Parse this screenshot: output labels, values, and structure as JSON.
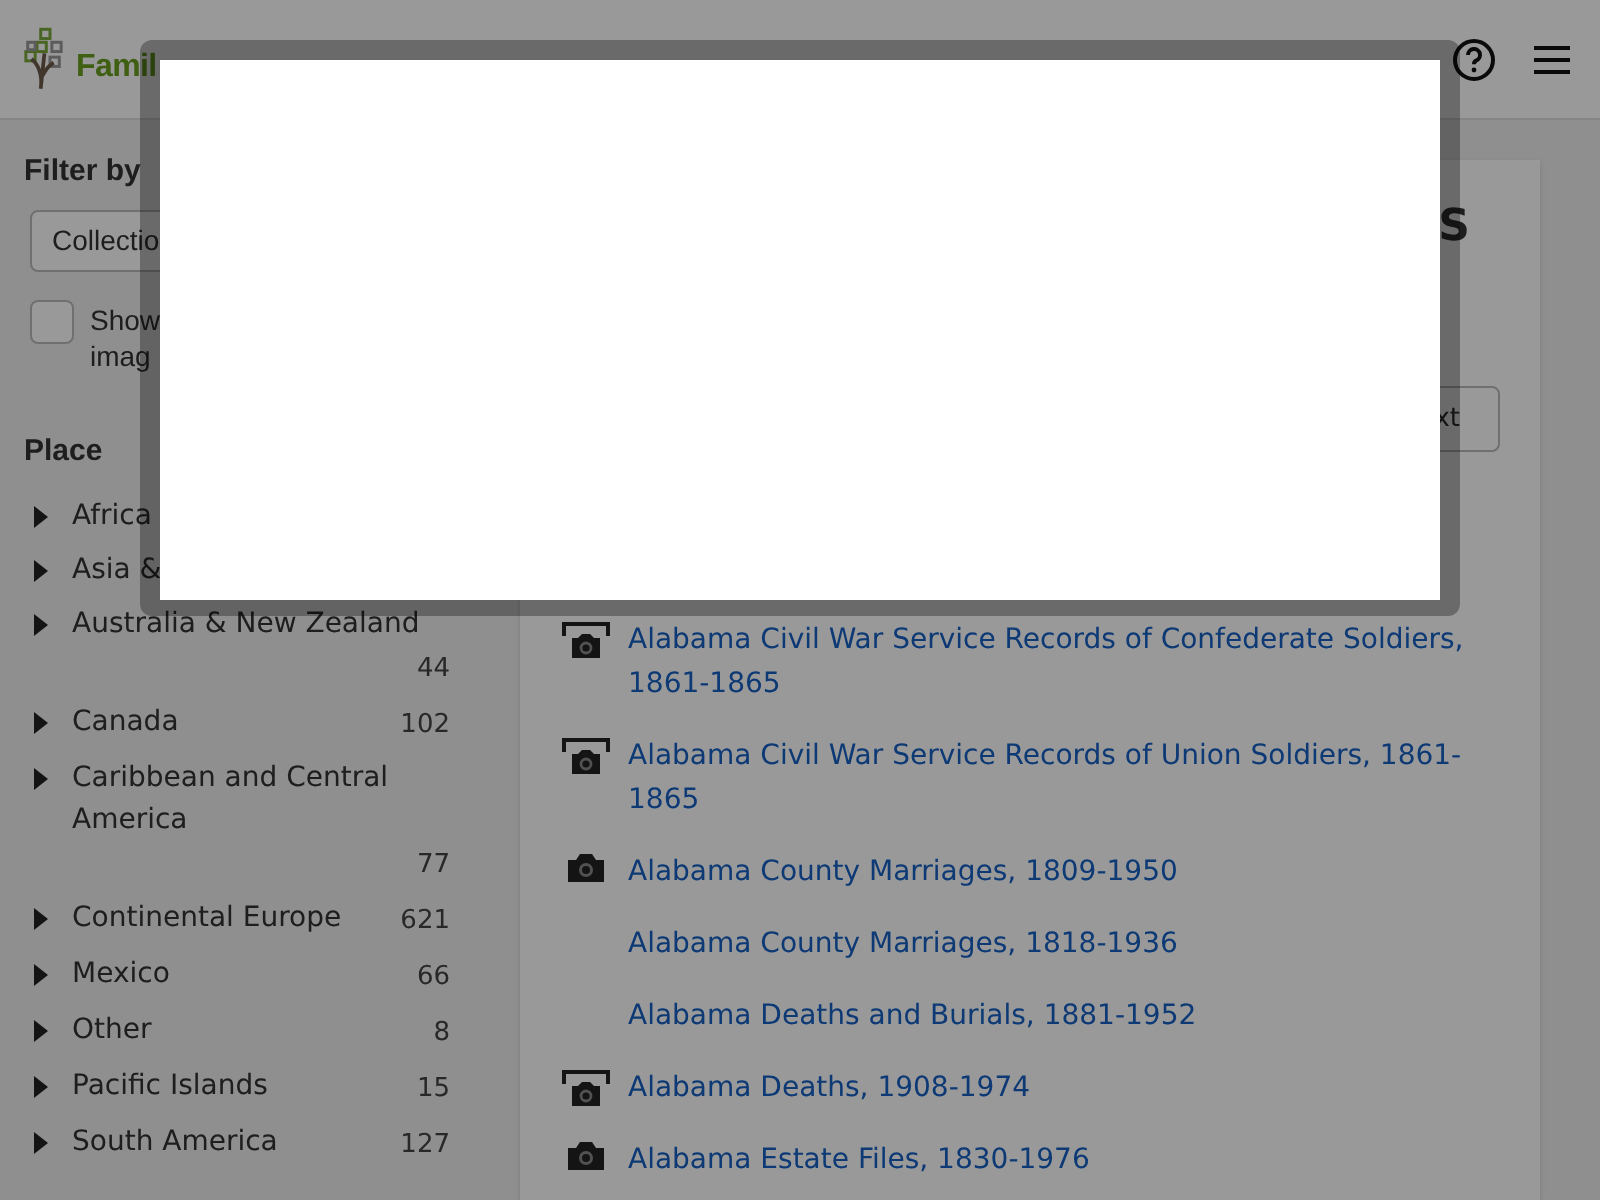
{
  "header": {
    "logo_text": "Famil"
  },
  "sidebar": {
    "title": "Filter by",
    "select": {
      "value": "Collectio"
    },
    "checkbox": {
      "label": "Show imag",
      "checked": false
    },
    "place_title": "Place",
    "places": [
      {
        "label": "Africa"
      },
      {
        "label": "Asia &"
      },
      {
        "label": "Australia & New Zealand",
        "count": "44"
      },
      {
        "label": "Canada",
        "count": "102"
      },
      {
        "label": "Caribbean and Central America",
        "count": "77"
      },
      {
        "label": "Continental Europe",
        "count": "621"
      },
      {
        "label": "Mexico",
        "count": "66"
      },
      {
        "label": "Other",
        "count": "8"
      },
      {
        "label": "Pacific Islands",
        "count": "15"
      },
      {
        "label": "South America",
        "count": "127"
      }
    ]
  },
  "main": {
    "heading": "S",
    "button": "xt",
    "collections": [
      {
        "title": "Alabama Civil War Service Records of Confederate Soldiers, 1861-1865",
        "kind": "browse"
      },
      {
        "title": "Alabama Civil War Service Records of Union Soldiers, 1861-1865",
        "kind": "browse"
      },
      {
        "title": "Alabama County Marriages, 1809-1950",
        "kind": "images"
      },
      {
        "title": "Alabama County Marriages, 1818-1936",
        "kind": "index"
      },
      {
        "title": "Alabama Deaths and Burials, 1881-1952",
        "kind": "index"
      },
      {
        "title": "Alabama Deaths, 1908-1974",
        "kind": "browse"
      },
      {
        "title": "Alabama Estate Files, 1830-1976",
        "kind": "images"
      }
    ]
  }
}
